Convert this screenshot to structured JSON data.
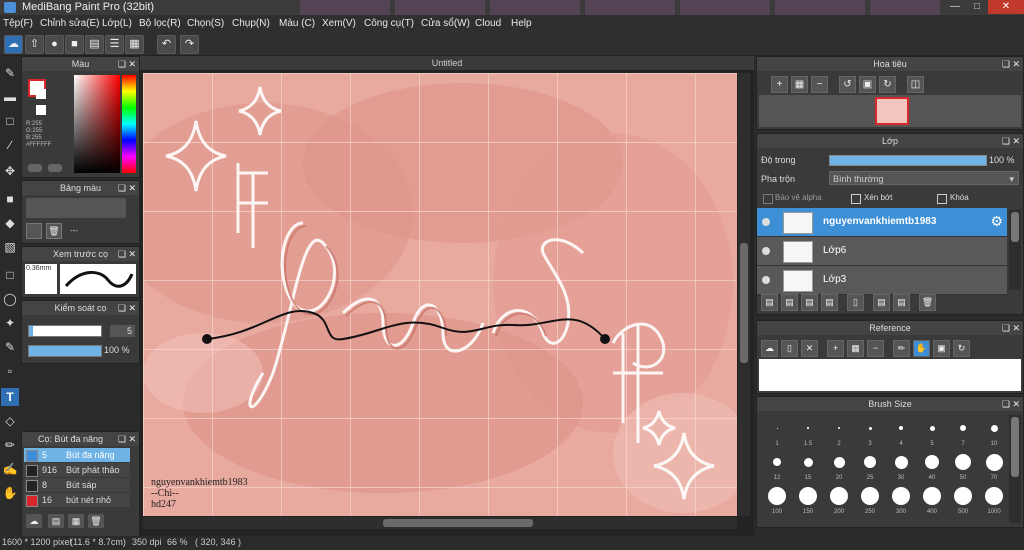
{
  "app": {
    "title": "MediBang Paint Pro (32bit)"
  },
  "menu": [
    "Tệp(F)",
    "Chỉnh sửa(E)",
    "Lớp(L)",
    "Bộ lọc(R)",
    "Chọn(S)",
    "Chụp(N)",
    "Màu (C)",
    "Xem(V)",
    "Công cụ(T)",
    "Cửa sổ(W)",
    "Cloud",
    "Help"
  ],
  "color_panel": {
    "title": "Màu",
    "r": "R:255",
    "g": "G:255",
    "b": "B:255",
    "hex": "#FFFFFF"
  },
  "palette_panel": {
    "title": "Bảng màu",
    "dash": "---"
  },
  "preview_panel": {
    "title": "Xem trước cọ",
    "size": "0.36mm"
  },
  "brush_ctrl": {
    "title": "Kiểm soát cọ",
    "size": "5",
    "opacity": "100 %"
  },
  "brush_list": {
    "title": "Cọ: Bút đa năng",
    "items": [
      {
        "size": "5",
        "name": "Bút đa năng",
        "color": "#3d8fd6"
      },
      {
        "size": "916",
        "name": "Bút phát thảo",
        "color": "#222222"
      },
      {
        "size": "8",
        "name": "Bút sáp",
        "color": "#222222"
      },
      {
        "size": "16",
        "name": "bút nét nhỏ",
        "color": "#d9262c"
      }
    ]
  },
  "canvas": {
    "tab": "Untitled",
    "signature": [
      "nguyenvankhiemtb1983",
      "--Chi--",
      "hd247"
    ]
  },
  "navigator": {
    "title": "Hoa tiêu"
  },
  "layer_panel": {
    "title": "Lớp",
    "opacity_label": "Độ trong",
    "opacity_value": "100 %",
    "blend_label": "Pha trộn",
    "blend_value": "Bình thường",
    "protect_alpha": "Bảo vệ alpha",
    "clip": "Xén bớt",
    "lock": "Khóa",
    "layers": [
      {
        "name": "nguyenvankhiemtb1983",
        "selected": true
      },
      {
        "name": "Lớp6",
        "selected": false
      },
      {
        "name": "Lớp3",
        "selected": false
      }
    ]
  },
  "reference": {
    "title": "Reference"
  },
  "brush_size": {
    "title": "Brush Size",
    "sizes": [
      "1",
      "1.5",
      "2",
      "3",
      "4",
      "5",
      "7",
      "10",
      "12",
      "15",
      "20",
      "25",
      "30",
      "40",
      "50",
      "70",
      "100",
      "150",
      "200",
      "250",
      "300",
      "400",
      "500",
      "1000"
    ]
  },
  "status": {
    "size": "1600 * 1200 pixel",
    "cm": "(11.6 * 8.7cm)",
    "dpi": "350 dpi",
    "zoom": "66 %",
    "coords": "( 320, 346 )"
  }
}
